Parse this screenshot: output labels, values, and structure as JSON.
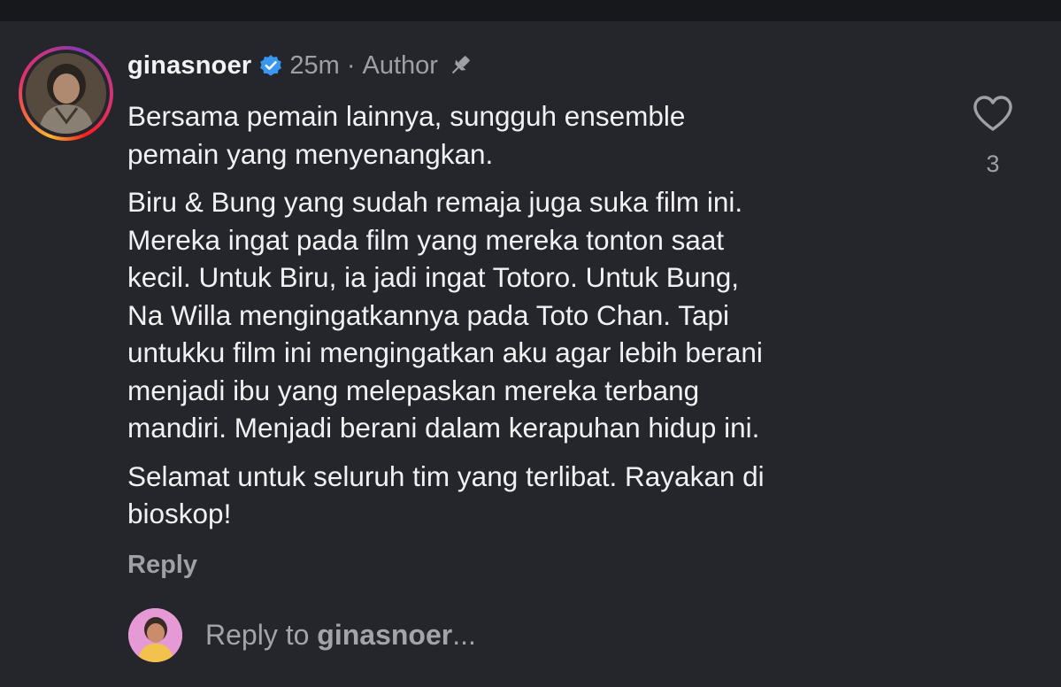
{
  "comment": {
    "username": "ginasnoer",
    "verified": true,
    "time_ago": "25m",
    "separator": "·",
    "role_label": "Author",
    "pinned": true,
    "paragraphs": [
      [
        "Bersama pemain lainnya, sungguh ensemble",
        "pemain yang menyenangkan."
      ],
      [
        "Biru & Bung yang sudah remaja juga suka film ini.",
        "Mereka ingat pada film yang mereka tonton saat",
        "kecil. Untuk Biru, ia jadi ingat Totoro. Untuk Bung,",
        "Na Willa mengingatkannya pada Toto Chan. Tapi",
        "untukku film ini mengingatkan aku agar lebih berani",
        "menjadi ibu yang melepaskan mereka terbang",
        "mandiri. Menjadi berani dalam kerapuhan hidup ini."
      ],
      [
        "Selamat untuk seluruh tim yang terlibat. Rayakan di",
        "bioskop!"
      ]
    ],
    "reply_label": "Reply",
    "like_count": "3"
  },
  "reply_box": {
    "prefix": "Reply to ",
    "target": "ginasnoer",
    "suffix": "..."
  },
  "icons": {
    "verified": "verified-badge-icon",
    "pin": "pin-icon",
    "like": "heart-outline-icon"
  },
  "colors": {
    "background": "#25262b",
    "text": "#f1f1f3",
    "muted": "#9ea0a6",
    "verified_blue": "#3897f0",
    "reply_avatar_bg": "#e59ad5"
  }
}
